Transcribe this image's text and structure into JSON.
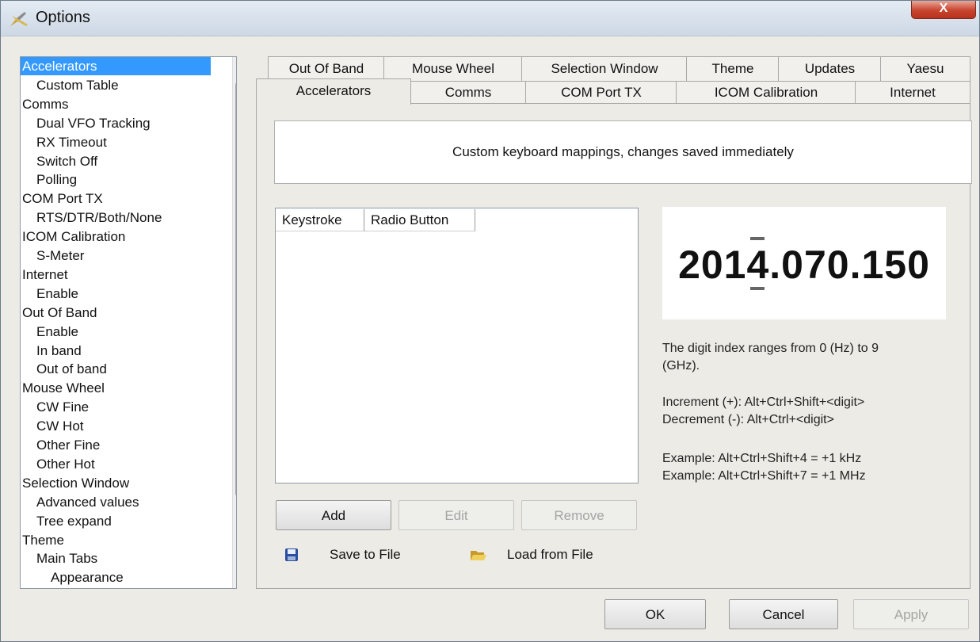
{
  "window": {
    "title": "Options",
    "close_label": "X"
  },
  "tree": {
    "items": [
      {
        "label": "Accelerators",
        "level": 0,
        "selected": true
      },
      {
        "label": "Custom Table",
        "level": 1
      },
      {
        "label": "Comms",
        "level": 0
      },
      {
        "label": "Dual VFO Tracking",
        "level": 1
      },
      {
        "label": "RX Timeout",
        "level": 1
      },
      {
        "label": "Switch Off",
        "level": 1
      },
      {
        "label": "Polling",
        "level": 1
      },
      {
        "label": "COM Port TX",
        "level": 0
      },
      {
        "label": "RTS/DTR/Both/None",
        "level": 1
      },
      {
        "label": "ICOM Calibration",
        "level": 0
      },
      {
        "label": "S-Meter",
        "level": 1
      },
      {
        "label": "Internet",
        "level": 0
      },
      {
        "label": "Enable",
        "level": 1
      },
      {
        "label": "Out Of Band",
        "level": 0
      },
      {
        "label": "Enable",
        "level": 1
      },
      {
        "label": "In band",
        "level": 1
      },
      {
        "label": "Out of band",
        "level": 1
      },
      {
        "label": "Mouse Wheel",
        "level": 0
      },
      {
        "label": "CW Fine",
        "level": 1
      },
      {
        "label": "CW Hot",
        "level": 1
      },
      {
        "label": "Other Fine",
        "level": 1
      },
      {
        "label": "Other Hot",
        "level": 1
      },
      {
        "label": "Selection Window",
        "level": 0
      },
      {
        "label": "Advanced values",
        "level": 1
      },
      {
        "label": "Tree expand",
        "level": 1
      },
      {
        "label": "Theme",
        "level": 0
      },
      {
        "label": "Main Tabs",
        "level": 1
      },
      {
        "label": "Appearance",
        "level": 2
      }
    ]
  },
  "tabs": {
    "row1": [
      "Out Of Band",
      "Mouse Wheel",
      "Selection Window",
      "Theme",
      "Updates",
      "Yaesu"
    ],
    "row2": [
      "Accelerators",
      "Comms",
      "COM Port TX",
      "ICOM Calibration",
      "Internet"
    ],
    "active": "Accelerators"
  },
  "accelerators": {
    "description": "Custom keyboard mappings, changes saved immediately",
    "columns": [
      "Keystroke",
      "Radio Button"
    ],
    "frequency_display": "2014.070.150",
    "info_line1": "The digit index ranges from 0 (Hz) to 9",
    "info_line2": "(GHz).",
    "increment": "Increment (+):  Alt+Ctrl+Shift+<digit>",
    "decrement": "Decrement (-):  Alt+Ctrl+<digit>",
    "example1": "Example:  Alt+Ctrl+Shift+4  =  +1 kHz",
    "example2": "Example:  Alt+Ctrl+Shift+7  =  +1 MHz",
    "buttons": {
      "add": "Add",
      "edit": "Edit",
      "remove": "Remove"
    },
    "save_label": "Save to File",
    "load_label": "Load from File"
  },
  "footer": {
    "ok": "OK",
    "cancel": "Cancel",
    "apply": "Apply"
  }
}
